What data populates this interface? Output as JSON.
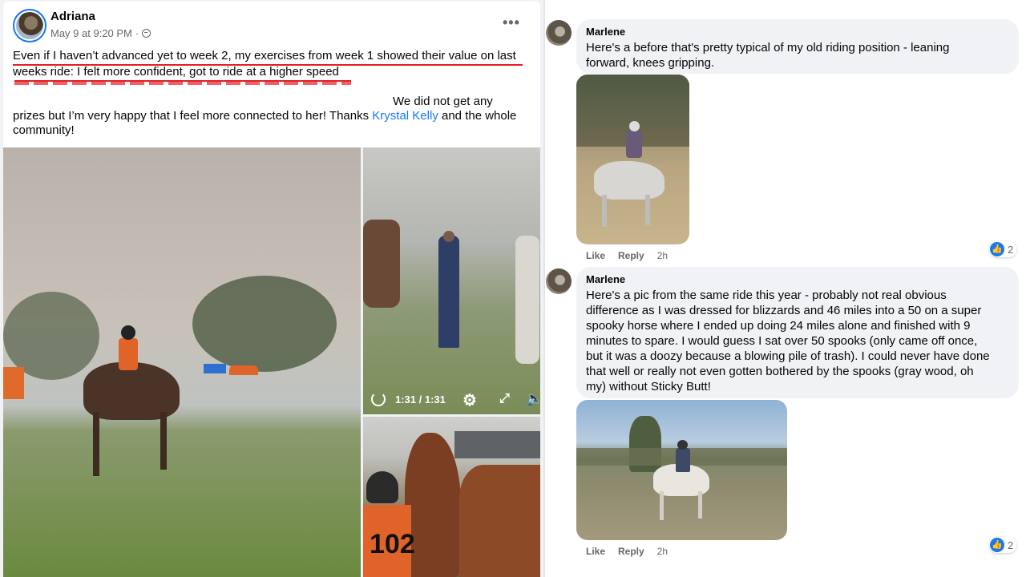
{
  "post": {
    "author": "Adriana",
    "date": "May 9 at 9:20 PM",
    "dot": "·",
    "more_label": "•••",
    "text_line1": "Even if I haven’t advanced yet to week 2, my exercises from week 1 showed their value on last",
    "text_line2": "weeks ride: I felt more confident, got to ride at a higher speed",
    "text_line3": "We did not get any",
    "text_line4_pre": "prizes but I’m very happy that I feel more connected to her! Thanks ",
    "text_line4_mention": "Krystal Kelly",
    "text_line4_post": " and the whole",
    "text_line5": "community!",
    "video": {
      "time": "1:31 / 1:31",
      "gear": "⚙",
      "expand": "⤢",
      "volume": "🔈"
    },
    "bib_number": "102"
  },
  "comments": [
    {
      "name": "Marlene",
      "line1": "Here's a before that's pretty typical of my old riding position - leaning",
      "line2": "forward, knees gripping.",
      "like": "Like",
      "reply": "Reply",
      "time": "2h",
      "reactions": "2"
    },
    {
      "name": "Marlene",
      "line1": "Here's a pic from the same ride this year - probably not real obvious",
      "line2": "difference as I was dressed for blizzards and 46 miles into a 50 on a super",
      "line3": "spooky horse where I ended up doing 24 miles alone and finished with 9",
      "line4": "minutes to spare. I would guess I sat over 50 spooks (only came off once,",
      "line5": "but it was a doozy because a blowing pile of trash). I could never have done",
      "line6": "that well or really not even gotten bothered by the spooks (gray wood, oh",
      "line7": "my) without Sticky Butt!",
      "like": "Like",
      "reply": "Reply",
      "time": "2h",
      "reactions": "2"
    }
  ],
  "icons": {
    "like": "thumbs-up-icon",
    "globe": "globe-icon"
  },
  "colors": {
    "link": "#1877f2",
    "underline": "#e41e26",
    "bubble": "#f0f2f5"
  }
}
